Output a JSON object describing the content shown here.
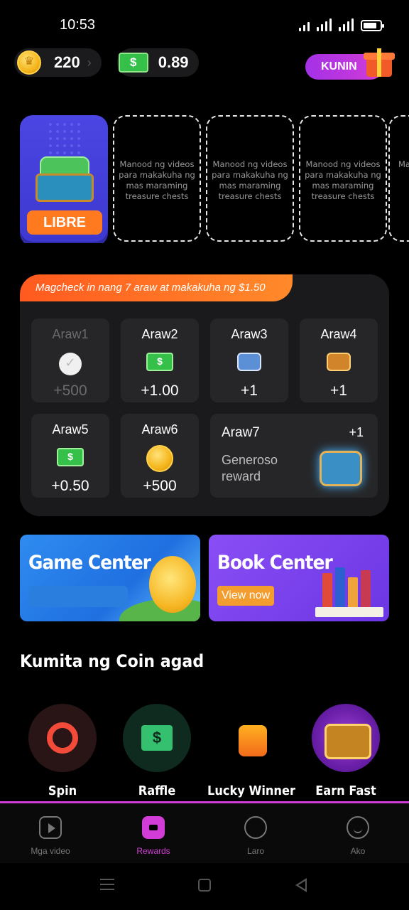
{
  "status_bar": {
    "time": "10:53"
  },
  "balance": {
    "coins": "220",
    "cash": "0.89"
  },
  "kunin_label": "KUNIN",
  "chests": {
    "libre_label": "LIBRE",
    "slot_text": "Manood ng videos para makakuha ng mas maraming treasure chests",
    "slot_partial": "Ma"
  },
  "checkin": {
    "banner": "Magcheck in nang 7 araw at makakuha ng $1.50",
    "days": [
      {
        "label": "Araw1",
        "amount": "+500",
        "icon": "check-icon",
        "done": true
      },
      {
        "label": "Araw2",
        "amount": "+1.00",
        "icon": "cash-icon"
      },
      {
        "label": "Araw3",
        "amount": "+1",
        "icon": "blue-chest-icon"
      },
      {
        "label": "Araw4",
        "amount": "+1",
        "icon": "gold-chest-icon"
      },
      {
        "label": "Araw5",
        "amount": "+0.50",
        "icon": "cash-icon"
      },
      {
        "label": "Araw6",
        "amount": "+500",
        "icon": "coin-icon"
      }
    ],
    "day7": {
      "label": "Araw7",
      "amount": "+1",
      "desc": "Generoso reward",
      "icon": "treasure-chest-icon"
    }
  },
  "promos": {
    "game": {
      "title": "Game Center"
    },
    "book": {
      "title": "Book Center",
      "cta": "View now"
    }
  },
  "earn": {
    "title": "Kumita ng Coin agad",
    "items": [
      {
        "label": "Spin",
        "icon": "roulette-icon"
      },
      {
        "label": "Raffle",
        "icon": "ticket-icon"
      },
      {
        "label": "Lucky Winner",
        "icon": "lucky-box-icon"
      },
      {
        "label": "Earn Fast",
        "icon": "treasure-icon"
      }
    ]
  },
  "nav": {
    "items": [
      {
        "label": "Mga video",
        "icon": "video-icon"
      },
      {
        "label": "Rewards",
        "icon": "rewards-icon",
        "active": true
      },
      {
        "label": "Laro",
        "icon": "game-icon"
      },
      {
        "label": "Ako",
        "icon": "profile-icon"
      }
    ]
  },
  "colors": {
    "accent": "#d23cd7",
    "orange": "#ff7a1f",
    "card_bg": "#1a1a1c"
  }
}
